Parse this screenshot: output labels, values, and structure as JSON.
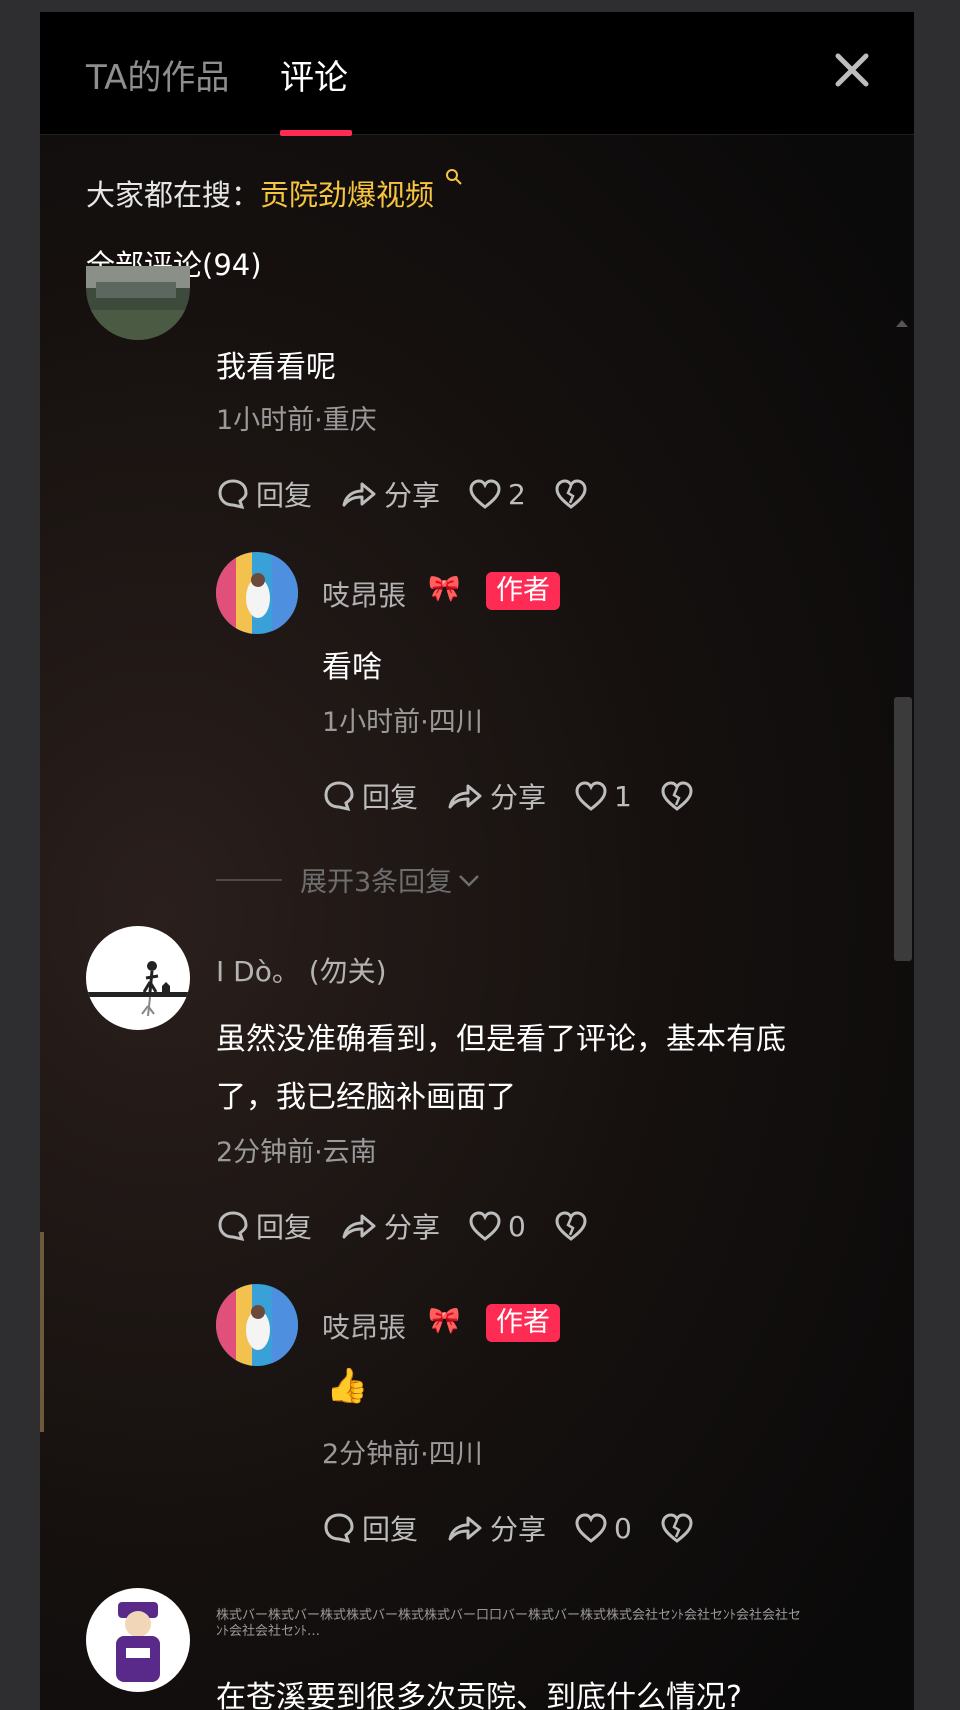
{
  "header": {
    "tab_works": "TA的作品",
    "tab_comments": "评论"
  },
  "hot_search": {
    "label": "大家都在搜：",
    "link": "贡院劲爆视频"
  },
  "comments_title": "全部评论(94)",
  "expand_replies": "展开3条回复",
  "actions_labels": {
    "reply": "回复",
    "share": "分享"
  },
  "comments": [
    {
      "text": "我看看呢",
      "meta": "1小时前·重庆",
      "likes": "2",
      "replies": [
        {
          "name": "吱昂張",
          "badge": "作者",
          "text": "看啥",
          "meta": "1小时前·四川",
          "likes": "1"
        }
      ]
    },
    {
      "name": "I Dò。 (勿关)",
      "text_line1": "虽然没准确看到，但是看了评论，基本有底",
      "text_line2": "了，我已经脑补画面了",
      "meta": "2分钟前·云南",
      "likes": "0",
      "replies": [
        {
          "name": "吱昂張",
          "badge": "作者",
          "text": "👍",
          "meta": "2分钟前·四川",
          "likes": "0"
        }
      ]
    },
    {
      "name": "株式バー株式バー株式株式バー株式株式バー口口バー株式バー株式株式会社セﾝﾄ会社セﾝﾄ会社会社セﾝﾄ会社会社セﾝﾄ…",
      "text": "在苍溪要到很多次贡院、到底什么情况?"
    }
  ],
  "colors": {
    "accent": "#fe2c55",
    "hot_link": "#f6c43e"
  }
}
